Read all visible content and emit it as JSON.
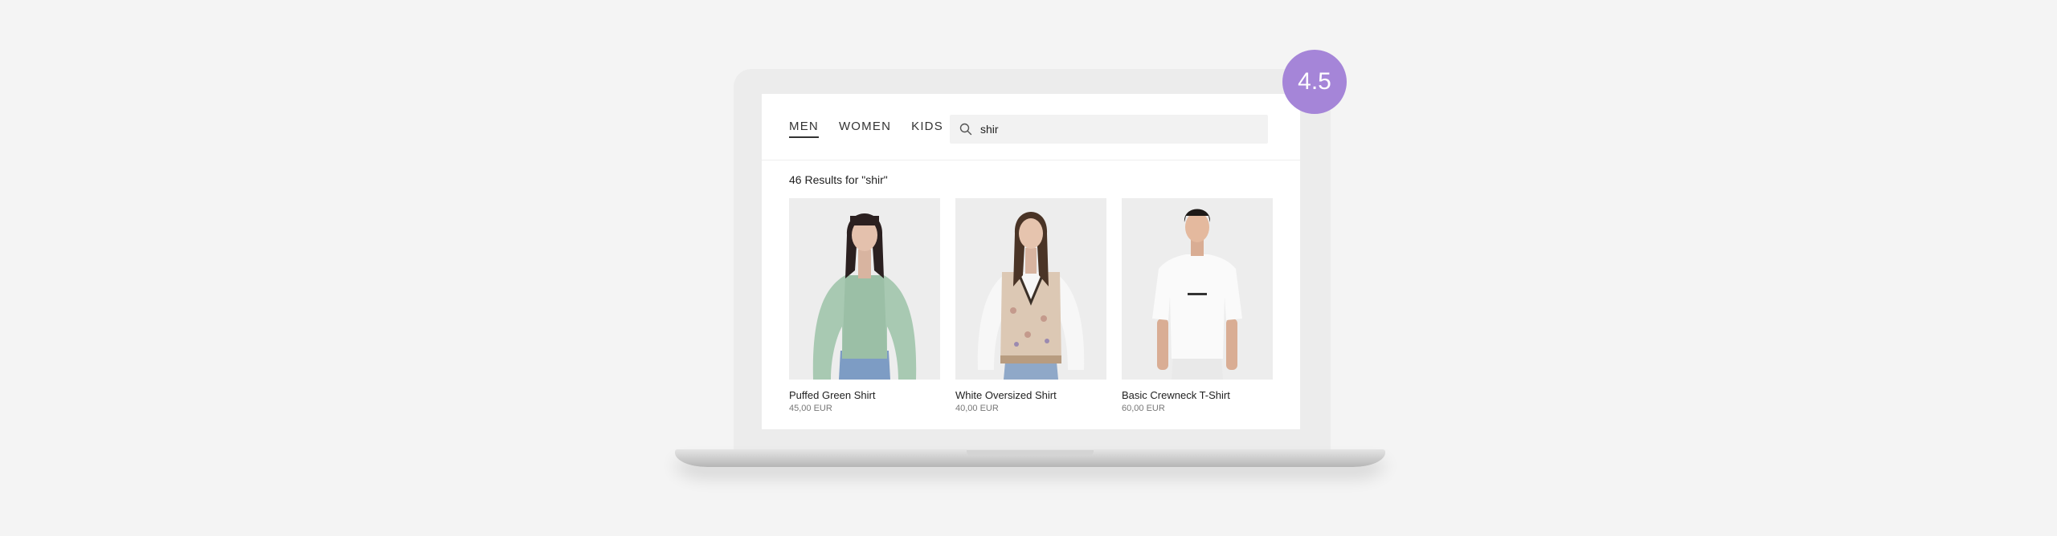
{
  "badge": {
    "version": "4.5"
  },
  "nav": {
    "items": [
      {
        "label": "MEN",
        "active": true
      },
      {
        "label": "WOMEN",
        "active": false
      },
      {
        "label": "KIDS",
        "active": false
      }
    ]
  },
  "search": {
    "value": "shir",
    "icon": "search-icon"
  },
  "results": {
    "count_text": "46 Results for \"shir\""
  },
  "products": [
    {
      "name": "Puffed Green Shirt",
      "price": "45,00 EUR"
    },
    {
      "name": "White Oversized Shirt",
      "price": "40,00 EUR"
    },
    {
      "name": "Basic Crewneck T-Shirt",
      "price": "60,00 EUR"
    }
  ],
  "colors": {
    "badge": "#a585d8",
    "page_background": "#f4f4f4"
  }
}
